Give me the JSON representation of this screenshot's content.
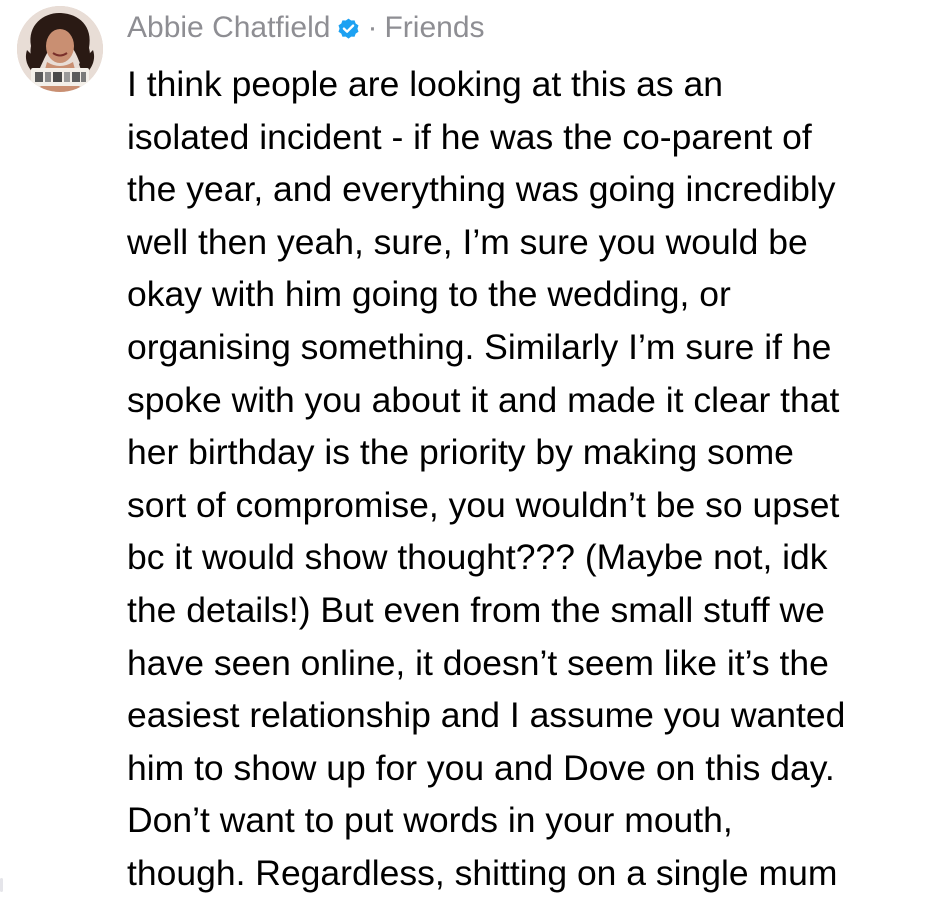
{
  "comment": {
    "author": "Abbie Chatfield",
    "verified_icon": "verified-badge-icon",
    "separator": "·",
    "audience": "Friends",
    "text": "I think people are looking at this as an\nisolated incident - if he was the co-parent of\nthe year, and everything was going incredibly\nwell then yeah, sure, I’m sure you would be\nokay with him going to the wedding, or\norganising something. Similarly I’m sure if he\nspoke with you about it and made it clear that\nher birthday is the priority by making some\nsort of compromise, you wouldn’t be so upset\nbc it would show thought??? (Maybe not, idk\nthe details!) But even from the small stuff we\nhave seen online, it doesn’t seem like it’s the\neasiest relationship and I assume you wanted\nhim to show up for you and Dove on this day.\nDon’t want to put words in your mouth,\nthough. Regardless, shitting on a single mum"
  },
  "colors": {
    "meta_text": "#8e8e93",
    "body_text": "#000000",
    "verified": "#1da1f2",
    "background": "#ffffff"
  }
}
